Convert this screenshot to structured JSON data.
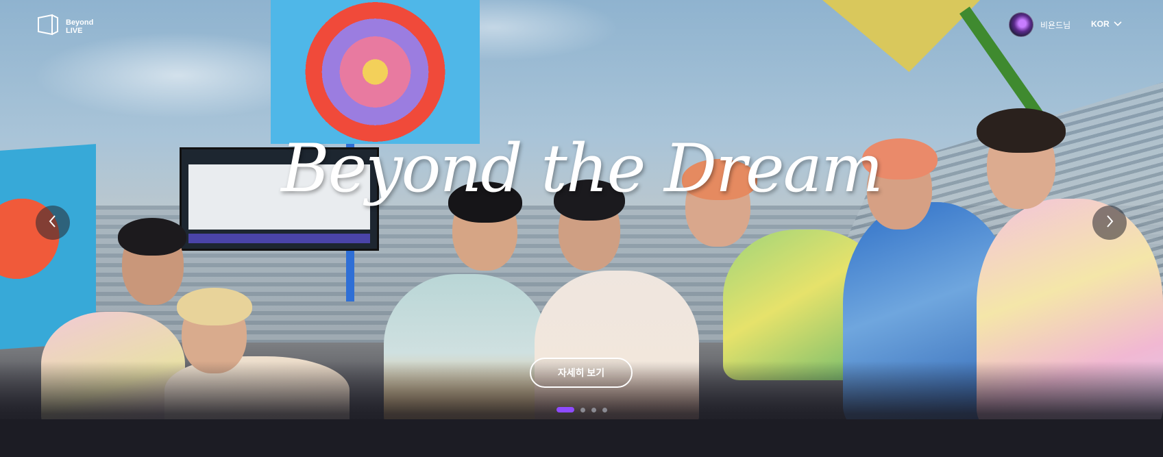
{
  "brand": {
    "logo_line1": "Beyond",
    "logo_line2": "LIVE"
  },
  "header": {
    "user_name": "비욘드님",
    "language": "KOR"
  },
  "hero": {
    "title": "Beyond the Dream",
    "cta_label": "자세히 보기",
    "slides": {
      "total": 4,
      "active_index": 0
    }
  },
  "colors": {
    "accent": "#8e4bff",
    "background": "#1c1c24"
  },
  "icons": {
    "prev": "chevron-left-icon",
    "next": "chevron-right-icon",
    "language": "chevron-down-icon",
    "logo": "beyond-live-logo-icon"
  }
}
